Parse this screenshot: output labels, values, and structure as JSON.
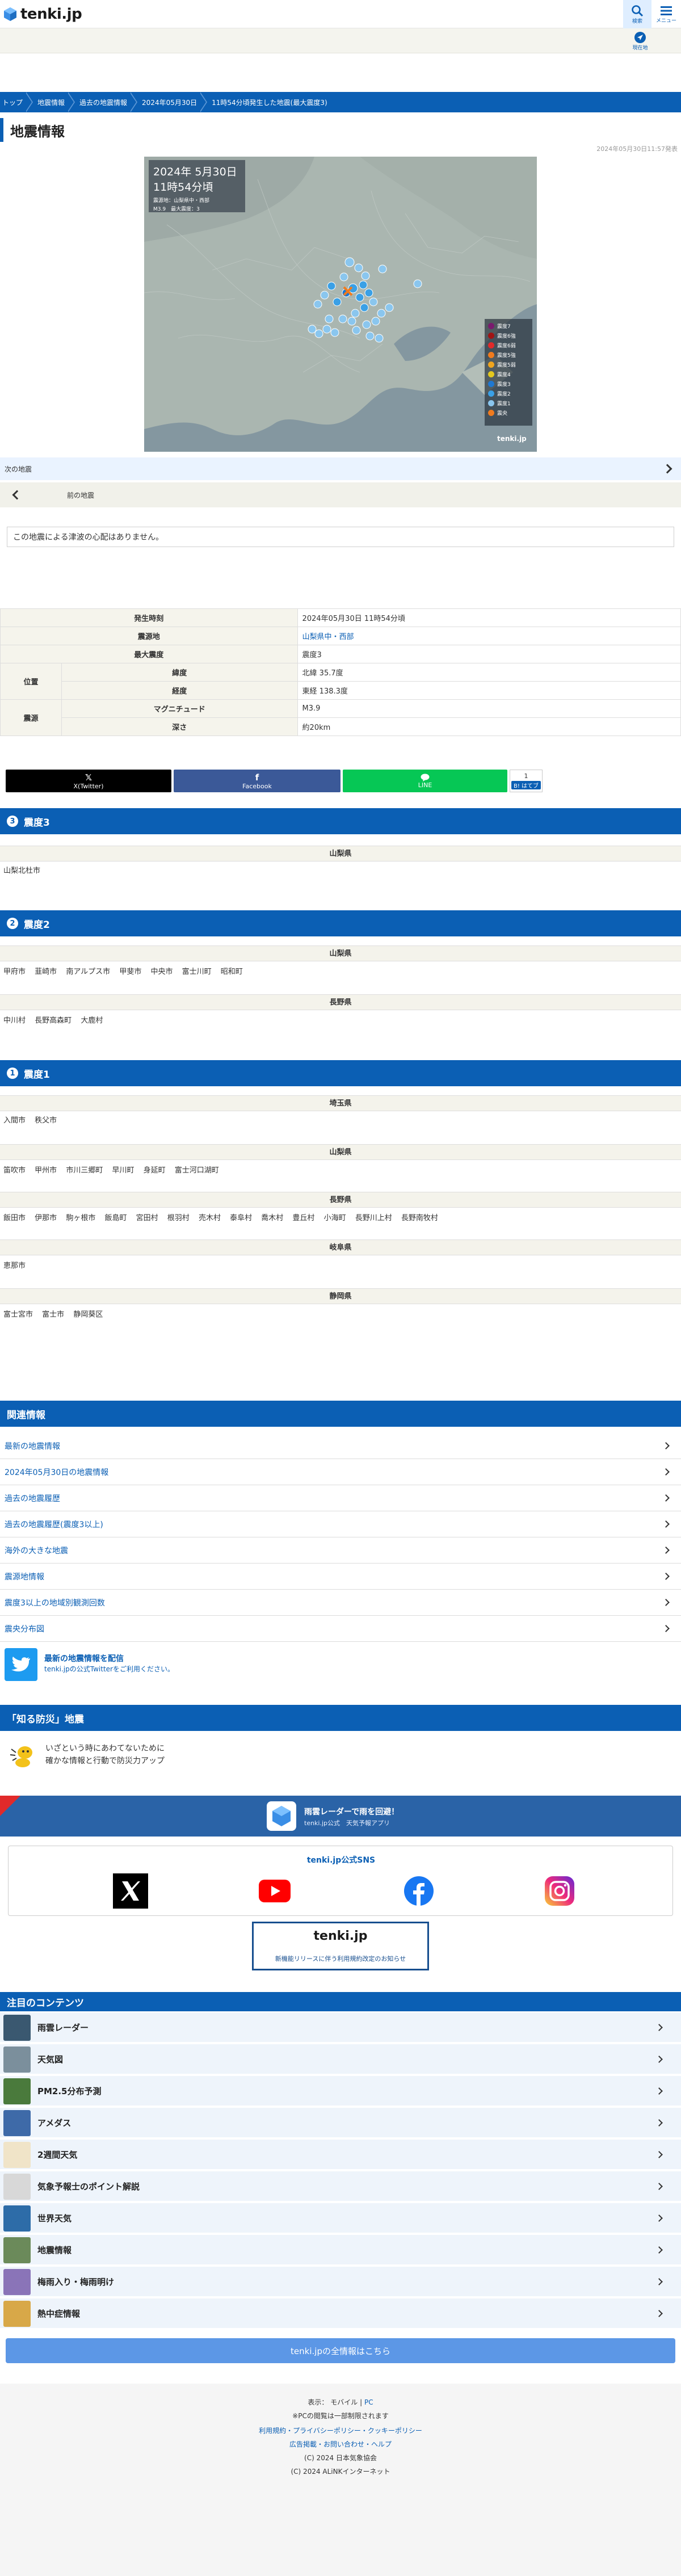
{
  "header": {
    "logo_text": "tenki.jp",
    "search_label": "検索",
    "menu_label": "メニュー",
    "current_location_label": "現在地"
  },
  "breadcrumb": [
    "トップ",
    "地震情報",
    "過去の地震情報",
    "2024年05月30日",
    "11時54分頃発生した地震(最大震度3)"
  ],
  "page": {
    "title": "地震情報",
    "published": "2024年05月30日11:57発表"
  },
  "map": {
    "date_line": "2024年 5月30日",
    "time_line": "11時54分頃",
    "caption_1": "震源地：山梨県中・西部",
    "caption_2": "M3.9　最大震度：3",
    "legend": [
      "震度7",
      "震度6強",
      "震度6弱",
      "震度5強",
      "震度5弱",
      "震度4",
      "震度3",
      "震度2",
      "震度1",
      "震央"
    ],
    "legend_colors": [
      "#7a1b6e",
      "#a01414",
      "#e12a2a",
      "#f07b1e",
      "#f0a51e",
      "#e4c81e",
      "#1f78d1",
      "#3aa0e6",
      "#8ac6ee",
      "#f07b1e"
    ],
    "brand": "tenki.jp"
  },
  "nav": {
    "next": "次の地震",
    "prev": "前の地震"
  },
  "tsunami_note": "この地震による津波の心配はありません。",
  "info": {
    "occurred_label": "発生時刻",
    "occurred": "2024年05月30日 11時54分頃",
    "epicenter_label": "震源地",
    "epicenter": "山梨県中・西部",
    "max_label": "最大震度",
    "max": "震度3",
    "position_label": "位置",
    "lat_label": "緯度",
    "lat": "北緯 35.7度",
    "lon_label": "経度",
    "lon": "東経 138.3度",
    "source_label": "震源",
    "mag_label": "マグニチュード",
    "mag": "M3.9",
    "depth_label": "深さ",
    "depth": "約20km"
  },
  "share": {
    "x": "X(Twitter)",
    "facebook": "Facebook",
    "line": "LINE",
    "count": "1",
    "bookmark": "B! はてブ"
  },
  "shindo3": {
    "badge": "3",
    "title": "震度3",
    "prefs": [
      {
        "name": "山梨県",
        "cities": [
          "山梨北杜市"
        ]
      }
    ]
  },
  "shindo2": {
    "badge": "2",
    "title": "震度2",
    "prefs": [
      {
        "name": "山梨県",
        "cities": [
          "甲府市",
          "韮崎市",
          "南アルプス市",
          "甲斐市",
          "中央市",
          "富士川町",
          "昭和町"
        ]
      },
      {
        "name": "長野県",
        "cities": [
          "中川村",
          "長野高森町",
          "大鹿村"
        ]
      }
    ]
  },
  "shindo1": {
    "badge": "1",
    "title": "震度1",
    "prefs": [
      {
        "name": "埼玉県",
        "cities": [
          "入間市",
          "秩父市"
        ]
      },
      {
        "name": "山梨県",
        "cities": [
          "笛吹市",
          "甲州市",
          "市川三郷町",
          "早川町",
          "身延町",
          "富士河口湖町"
        ]
      },
      {
        "name": "長野県",
        "cities": [
          "飯田市",
          "伊那市",
          "駒ヶ根市",
          "飯島町",
          "宮田村",
          "根羽村",
          "売木村",
          "泰阜村",
          "喬木村",
          "豊丘村",
          "小海町",
          "長野川上村",
          "長野南牧村"
        ]
      },
      {
        "name": "岐阜県",
        "cities": [
          "恵那市"
        ]
      },
      {
        "name": "静岡県",
        "cities": [
          "富士宮市",
          "富士市",
          "静岡葵区"
        ]
      }
    ]
  },
  "related": {
    "title": "関連情報",
    "items": [
      "最新の地震情報",
      "2024年05月30日の地震情報",
      "過去の地震履歴",
      "過去の地震履歴(震度3以上)",
      "海外の大きな地震",
      "震源地情報",
      "震度3以上の地域別観測回数",
      "震央分布図"
    ]
  },
  "twitter": {
    "title": "最新の地震情報を配信",
    "sub": "tenki.jpの公式Twitterをご利用ください。"
  },
  "bousai": {
    "title": "「知る防災」地震",
    "line1": "いざという時にあわてないために",
    "line2": "確かな情報と行動で防災力アップ"
  },
  "banner": {
    "title": "雨雲レーダーで雨を回避！",
    "sub": "tenki.jp公式　天気予報アプリ"
  },
  "sns": {
    "title": "tenki.jp公式SNS"
  },
  "notice": {
    "logo": "tenki.jp",
    "text": "新機能リリースに伴う利用規約改定のお知らせ"
  },
  "featured": {
    "title": "注目のコンテンツ",
    "items": [
      {
        "label": "雨雲レーダー",
        "color": "#3a5870"
      },
      {
        "label": "天気図",
        "color": "#7b8f9c"
      },
      {
        "label": "PM2.5分布予測",
        "color": "#4a7a3c"
      },
      {
        "label": "アメダス",
        "color": "#3e6aa8"
      },
      {
        "label": "2週間天気",
        "color": "#f0e4c8"
      },
      {
        "label": "気象予報士のポイント解説",
        "color": "#d8d8d8"
      },
      {
        "label": "世界天気",
        "color": "#2d6ca8"
      },
      {
        "label": "地震情報",
        "color": "#6b8a5a"
      },
      {
        "label": "梅雨入り・梅雨明け",
        "color": "#8a74b8"
      },
      {
        "label": "熱中症情報",
        "color": "#d8a848"
      }
    ],
    "all_label": "tenki.jpの全情報はこちら"
  },
  "footer": {
    "display_label": "表示：",
    "mobile": "モバイル",
    "pc": "PC",
    "pc_note": "※PCの閲覧は一部制限されます",
    "links1": "利用規約・プライバシーポリシー・クッキーポリシー",
    "links2": "広告掲載・お問い合わせ・ヘルプ",
    "copy1": "(C) 2024 日本気象協会",
    "copy2": "(C) 2024 ALiNKインターネット"
  }
}
